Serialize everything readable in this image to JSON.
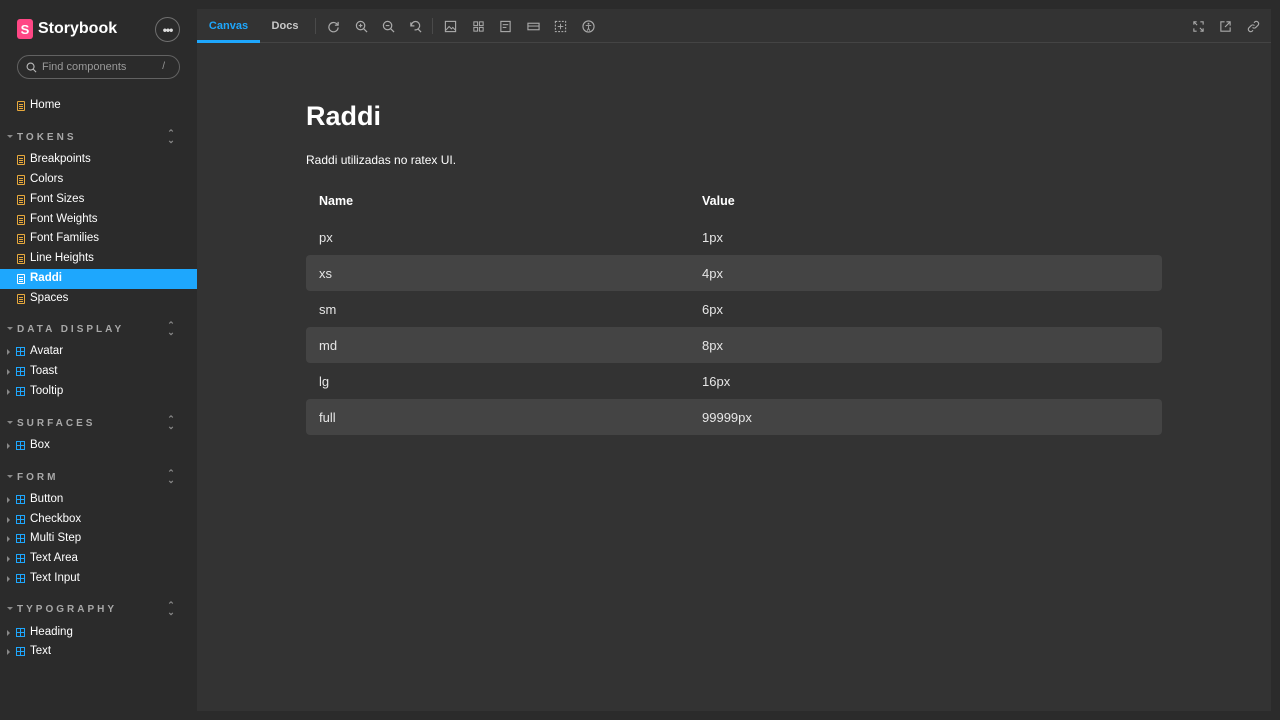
{
  "brand": {
    "logo_letter": "S",
    "name": "Storybook"
  },
  "menu_button": {
    "label": "•••"
  },
  "search": {
    "placeholder": "Find components",
    "shortcut": "/"
  },
  "sidebar": {
    "home": {
      "label": "Home"
    },
    "groups": [
      {
        "title": "TOKENS",
        "toggle": "⌃⌄",
        "items": [
          "Breakpoints",
          "Colors",
          "Font Sizes",
          "Font Weights",
          "Font Families",
          "Line Heights",
          "Raddi",
          "Spaces"
        ]
      },
      {
        "title": "DATA DISPLAY",
        "toggle": "⌃⌄",
        "items": [
          "Avatar",
          "Toast",
          "Tooltip"
        ]
      },
      {
        "title": "SURFACES",
        "toggle": "⌃⌄",
        "items": [
          "Box"
        ]
      },
      {
        "title": "FORM",
        "toggle": "⌃⌄",
        "items": [
          "Button",
          "Checkbox",
          "Multi Step",
          "Text Area",
          "Text Input"
        ]
      },
      {
        "title": "TYPOGRAPHY",
        "toggle": "⌃⌄",
        "items": [
          "Heading",
          "Text"
        ]
      }
    ],
    "selected": "Raddi"
  },
  "toolbar": {
    "tabs": [
      "Canvas",
      "Docs"
    ],
    "active_tab": "Canvas",
    "icons": [
      "reload-icon",
      "zoom-in-icon",
      "zoom-out-icon",
      "zoom-reset-icon",
      "image-icon",
      "grid-icon",
      "outline-icon",
      "measure-icon",
      "background-icon",
      "accessibility-icon",
      "fullscreen-icon",
      "open-new-tab-icon",
      "link-icon"
    ]
  },
  "doc": {
    "title": "Raddi",
    "description": "Raddi utilizadas no ratex UI.",
    "table": {
      "headers": [
        "Name",
        "Value"
      ],
      "rows": [
        [
          "px",
          "1px"
        ],
        [
          "xs",
          "4px"
        ],
        [
          "sm",
          "6px"
        ],
        [
          "md",
          "8px"
        ],
        [
          "lg",
          "16px"
        ],
        [
          "full",
          "99999px"
        ]
      ]
    }
  },
  "colors": {
    "accent": "#1ea7fd",
    "brand": "#ff4785",
    "doc_icon": "#e8a93c"
  }
}
